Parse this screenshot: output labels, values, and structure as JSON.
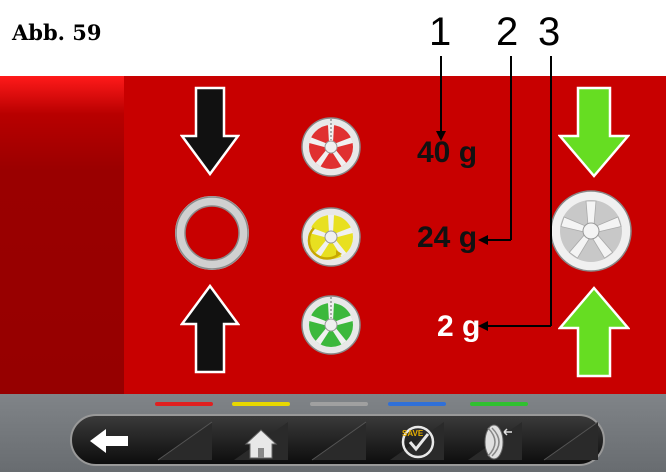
{
  "header": {
    "figure_label": "Abb. 59",
    "callouts": [
      "1",
      "2",
      "3"
    ]
  },
  "weights": {
    "top": "40 g",
    "middle": "24 g",
    "bottom": "2 g"
  },
  "colors": {
    "main_bg": "#c80000",
    "left_panel": "#960000",
    "arrow_black": "#111111",
    "arrow_green": "#66dd22",
    "wheel_red": "#e03030",
    "wheel_yellow": "#e8e020",
    "wheel_green": "#3cb83c",
    "bottom_bar": "#6c7074"
  },
  "indicator_bars": [
    {
      "name": "red",
      "color": "#e02020"
    },
    {
      "name": "yellow",
      "color": "#e8d800"
    },
    {
      "name": "gray",
      "color": "#a0a0a0"
    },
    {
      "name": "blue",
      "color": "#3070d8"
    },
    {
      "name": "green",
      "color": "#30c030"
    }
  ],
  "toolbar": {
    "back": "arrow-left-icon",
    "home": "home-icon",
    "save_label": "SAVE",
    "wheel": "wheel-side-icon"
  }
}
